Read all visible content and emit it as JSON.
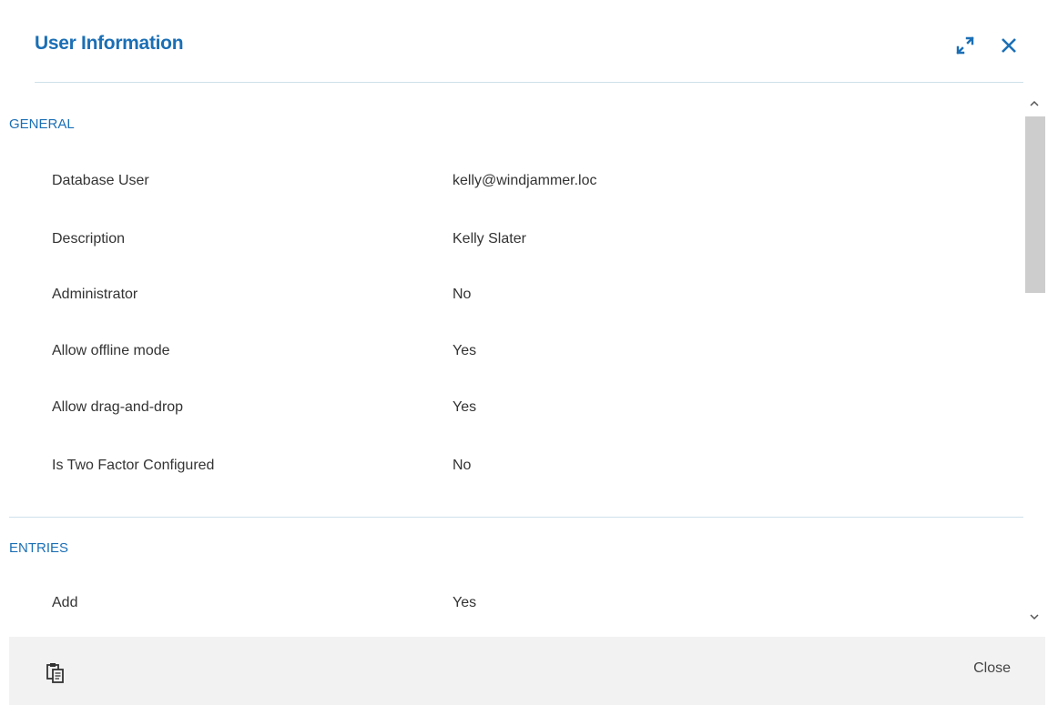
{
  "dialog": {
    "title": "User Information",
    "expand_icon": "expand-icon",
    "close_icon": "close-icon",
    "accent_color": "#1b6fb5"
  },
  "sections": {
    "general": {
      "title": "GENERAL",
      "rows": [
        {
          "label": "Database User",
          "value": "kelly@windjammer.loc"
        },
        {
          "label": "Description",
          "value": "Kelly Slater"
        },
        {
          "label": "Administrator",
          "value": "No"
        },
        {
          "label": "Allow offline mode",
          "value": "Yes"
        },
        {
          "label": "Allow drag-and-drop",
          "value": "Yes"
        },
        {
          "label": "Is Two Factor Configured",
          "value": "No"
        }
      ]
    },
    "entries": {
      "title": "ENTRIES",
      "rows": [
        {
          "label": "Add",
          "value": "Yes"
        }
      ]
    }
  },
  "footer": {
    "copy_icon": "clipboard-icon",
    "close_label": "Close"
  }
}
